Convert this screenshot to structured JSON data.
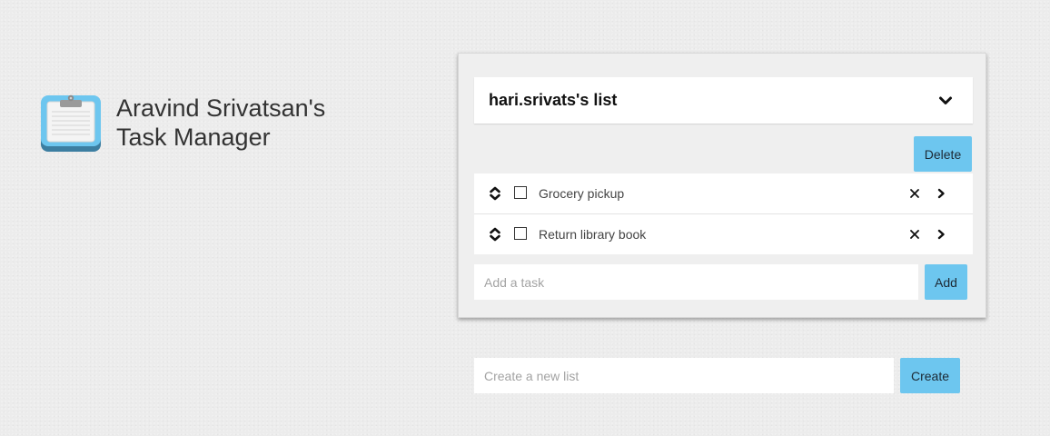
{
  "brand": {
    "title_line1": "Aravind Srivatsan's",
    "title_line2": "Task Manager",
    "logo_icon": "clipboard-icon"
  },
  "list": {
    "title": "hari.srivats's list",
    "toggle_icon": "chevron-down-icon",
    "delete_label": "Delete",
    "tasks": [
      {
        "label": "Grocery pickup",
        "completed": false
      },
      {
        "label": "Return library book",
        "completed": false
      }
    ],
    "add_task_placeholder": "Add a task",
    "add_task_value": "",
    "add_label": "Add"
  },
  "new_list": {
    "placeholder": "Create a new list",
    "value": "",
    "create_label": "Create"
  },
  "colors": {
    "accent": "#6dc6ef",
    "background": "#ececec",
    "panel": "#efefef"
  }
}
